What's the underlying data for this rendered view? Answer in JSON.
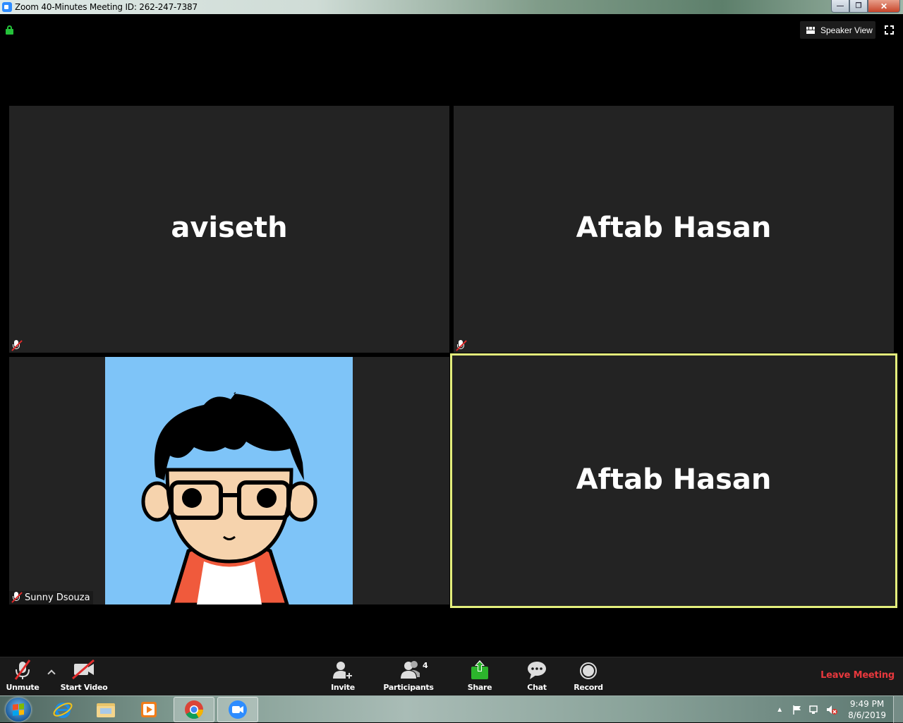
{
  "window": {
    "title": "Zoom 40-Minutes Meeting ID: 262-247-7387",
    "minimize_icon": "minimize-icon",
    "maximize_icon": "maximize-icon",
    "close_icon": "close-icon"
  },
  "top_bar": {
    "speaker_view_label": "Speaker View"
  },
  "tiles": [
    {
      "name": "aviseth",
      "muted": true
    },
    {
      "name": "Aftab Hasan",
      "muted": true
    },
    {
      "name": "Sunny Dsouza",
      "muted": true,
      "has_avatar": true
    },
    {
      "name": "Aftab Hasan",
      "active_speaker": true
    }
  ],
  "colors": {
    "active_speaker_border": "#e4ef7c",
    "leave_red": "#e8383d",
    "share_green": "#2cb52c",
    "lock_green": "#25c23a",
    "avatar_bg": "#7ec4f8"
  },
  "toolbar": {
    "unmute_label": "Unmute",
    "start_video_label": "Start Video",
    "invite_label": "Invite",
    "participants_label": "Participants",
    "participants_count": "4",
    "share_label": "Share",
    "chat_label": "Chat",
    "record_label": "Record",
    "leave_label": "Leave Meeting"
  },
  "taskbar": {
    "apps": [
      "internet-explorer-icon",
      "file-explorer-icon",
      "media-player-icon",
      "chrome-icon",
      "zoom-icon"
    ],
    "time": "9:49 PM",
    "date": "8/6/2019"
  }
}
